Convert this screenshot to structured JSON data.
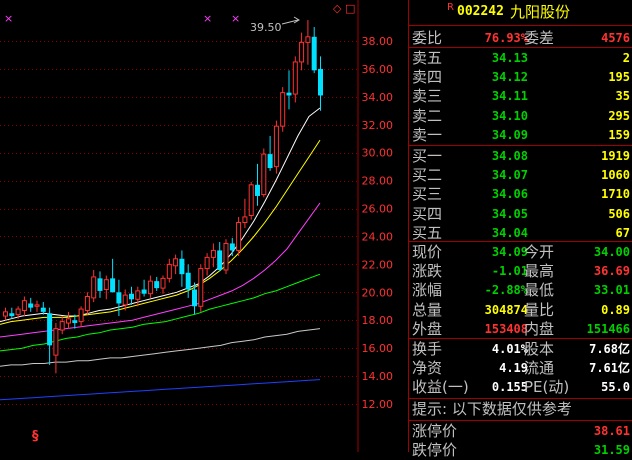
{
  "colors": {
    "up": "#ff3232",
    "down": "#00e0ff",
    "green": "#00d000",
    "yellow": "#ffff00",
    "gray": "#c0c0c0",
    "white": "#ffffff",
    "grid": "#8b0000",
    "ma_white": "#ffffff",
    "ma_yellow": "#ffff00",
    "ma_magenta": "#ff40ff",
    "ma_green": "#00ff00",
    "ma_gray": "#c8c8c8",
    "ma_blue": "#2040ff"
  },
  "header": {
    "r_mark": "R",
    "code": "002242",
    "name": "九阳股份"
  },
  "chart": {
    "top_markers": [
      "×",
      "×",
      "×"
    ],
    "top_right_icons": [
      "◇",
      "□"
    ],
    "bottom_marker": "§",
    "high_label": "39.50"
  },
  "chart_data": {
    "type": "candlestick",
    "y_axis_ticks": [
      "38.00",
      "36.00",
      "34.00",
      "32.00",
      "30.00",
      "28.00",
      "26.00",
      "24.00",
      "22.00",
      "20.00",
      "18.00",
      "16.00",
      "14.00",
      "12.00"
    ],
    "ylim": [
      12,
      38
    ],
    "annotations": [
      {
        "label": "39.50",
        "kind": "period high"
      }
    ],
    "candles": [
      [
        18.3,
        18.9,
        18.0,
        18.6
      ],
      [
        18.5,
        18.9,
        18.1,
        18.3
      ],
      [
        18.4,
        19.0,
        18.1,
        18.8
      ],
      [
        18.7,
        19.7,
        18.3,
        19.4
      ],
      [
        19.2,
        19.6,
        18.6,
        18.9
      ],
      [
        19.0,
        19.4,
        18.6,
        19.1
      ],
      [
        18.9,
        19.3,
        18.4,
        18.6
      ],
      [
        18.5,
        18.9,
        14.8,
        16.2
      ],
      [
        15.5,
        17.8,
        14.2,
        17.4
      ],
      [
        17.3,
        18.3,
        17.0,
        17.9
      ],
      [
        17.8,
        18.6,
        17.4,
        18.1
      ],
      [
        18.0,
        18.4,
        17.4,
        17.8
      ],
      [
        17.9,
        19.0,
        17.5,
        18.8
      ],
      [
        18.7,
        20.0,
        18.4,
        19.7
      ],
      [
        19.6,
        21.6,
        19.3,
        21.1
      ],
      [
        21.0,
        21.5,
        19.6,
        20.1
      ],
      [
        20.2,
        21.2,
        19.5,
        20.9
      ],
      [
        21.0,
        22.4,
        20.5,
        20.0
      ],
      [
        20.0,
        20.9,
        18.3,
        19.2
      ],
      [
        19.1,
        20.2,
        18.7,
        19.8
      ],
      [
        19.9,
        20.4,
        19.1,
        19.5
      ],
      [
        19.5,
        20.4,
        19.0,
        20.1
      ],
      [
        20.2,
        20.9,
        19.7,
        19.9
      ],
      [
        19.9,
        21.2,
        19.6,
        20.8
      ],
      [
        20.8,
        21.1,
        20.1,
        20.3
      ],
      [
        20.3,
        21.2,
        19.9,
        21.0
      ],
      [
        21.0,
        22.4,
        20.7,
        22.0
      ],
      [
        21.9,
        22.7,
        21.3,
        22.4
      ],
      [
        22.4,
        23.0,
        20.4,
        21.3
      ],
      [
        21.4,
        22.0,
        19.6,
        20.2
      ],
      [
        20.2,
        20.7,
        18.4,
        19.0
      ],
      [
        19.0,
        22.0,
        18.6,
        21.7
      ],
      [
        21.7,
        22.8,
        21.2,
        22.5
      ],
      [
        22.5,
        23.5,
        21.8,
        23.0
      ],
      [
        23.0,
        23.6,
        21.5,
        21.6
      ],
      [
        21.6,
        23.8,
        21.3,
        23.5
      ],
      [
        23.5,
        23.9,
        22.6,
        23.0
      ],
      [
        23.0,
        25.4,
        22.6,
        25.0
      ],
      [
        25.0,
        26.7,
        24.6,
        25.4
      ],
      [
        25.5,
        27.9,
        25.2,
        27.7
      ],
      [
        27.7,
        29.2,
        26.2,
        26.9
      ],
      [
        27.0,
        30.3,
        26.8,
        29.9
      ],
      [
        29.9,
        31.2,
        28.7,
        28.9
      ],
      [
        29.0,
        32.3,
        28.5,
        31.9
      ],
      [
        31.9,
        34.7,
        31.5,
        34.3
      ],
      [
        34.3,
        35.9,
        33.1,
        34.1
      ],
      [
        34.2,
        36.9,
        33.6,
        36.5
      ],
      [
        36.5,
        38.6,
        35.9,
        37.9
      ],
      [
        37.9,
        39.5,
        36.3,
        38.3
      ],
      [
        38.3,
        39.0,
        35.7,
        35.9
      ],
      [
        36.0,
        36.9,
        33.0,
        34.1
      ]
    ],
    "moving_averages": [
      {
        "color_key": "ma_white",
        "start": 17.9,
        "points": [
          18.1,
          18.3,
          18.4,
          18.5,
          18.4,
          18.3,
          18.3,
          18.5,
          18.7,
          18.8,
          19.0,
          19.2,
          19.4,
          19.6,
          19.8,
          20.0,
          20.3,
          20.6,
          21.2,
          21.9,
          22.8,
          23.9,
          25.1,
          26.5,
          28.0,
          29.6,
          31.2,
          32.6,
          33.2
        ]
      },
      {
        "color_key": "ma_yellow",
        "start": 17.7,
        "points": [
          17.9,
          18.0,
          18.1,
          18.2,
          18.2,
          18.2,
          18.3,
          18.4,
          18.5,
          18.6,
          18.8,
          19.0,
          19.2,
          19.4,
          19.6,
          19.8,
          20.1,
          20.5,
          21.0,
          21.6,
          22.3,
          23.1,
          24.0,
          25.0,
          26.1,
          27.3,
          28.5,
          29.7,
          30.9
        ]
      },
      {
        "color_key": "ma_magenta",
        "start": 16.8,
        "points": [
          16.9,
          17.0,
          17.1,
          17.2,
          17.3,
          17.4,
          17.5,
          17.6,
          17.7,
          17.8,
          17.9,
          18.0,
          18.2,
          18.4,
          18.6,
          18.8,
          19.0,
          19.2,
          19.5,
          19.8,
          20.1,
          20.5,
          21.0,
          21.6,
          22.3,
          23.1,
          24.2,
          25.3,
          26.4
        ]
      },
      {
        "color_key": "ma_green",
        "start": 15.8,
        "points": [
          15.9,
          16.0,
          16.2,
          16.3,
          16.5,
          16.7,
          16.8,
          17.0,
          17.1,
          17.3,
          17.4,
          17.5,
          17.7,
          17.8,
          17.9,
          18.1,
          18.3,
          18.5,
          18.8,
          19.0,
          19.2,
          19.4,
          19.6,
          19.9,
          20.1,
          20.4,
          20.7,
          21.0,
          21.3
        ]
      },
      {
        "color_key": "ma_gray",
        "start": 14.7,
        "points": [
          14.8,
          14.8,
          14.9,
          14.9,
          15.0,
          15.0,
          15.1,
          15.1,
          15.2,
          15.3,
          15.3,
          15.4,
          15.5,
          15.6,
          15.7,
          15.8,
          15.9,
          16.0,
          16.1,
          16.2,
          16.4,
          16.5,
          16.6,
          16.8,
          16.9,
          17.0,
          17.2,
          17.3,
          17.4
        ]
      },
      {
        "color_key": "ma_blue",
        "start": 12.3,
        "points": [
          12.35,
          12.4,
          12.45,
          12.5,
          12.55,
          12.6,
          12.65,
          12.7,
          12.75,
          12.8,
          12.85,
          12.9,
          12.95,
          13.0,
          13.05,
          13.1,
          13.15,
          13.2,
          13.25,
          13.3,
          13.35,
          13.4,
          13.45,
          13.5,
          13.55,
          13.6,
          13.65,
          13.7,
          13.75
        ]
      }
    ]
  },
  "quote": {
    "wei": {
      "l1": "委比",
      "v1": "76.93%",
      "l2": "委差",
      "v2": "4576"
    },
    "sell": [
      {
        "label": "卖五",
        "price": "34.13",
        "vol": "2"
      },
      {
        "label": "卖四",
        "price": "34.12",
        "vol": "195"
      },
      {
        "label": "卖三",
        "price": "34.11",
        "vol": "35"
      },
      {
        "label": "卖二",
        "price": "34.10",
        "vol": "295"
      },
      {
        "label": "卖一",
        "price": "34.09",
        "vol": "159"
      }
    ],
    "buy": [
      {
        "label": "买一",
        "price": "34.08",
        "vol": "1919"
      },
      {
        "label": "买二",
        "price": "34.07",
        "vol": "1060"
      },
      {
        "label": "买三",
        "price": "34.06",
        "vol": "1710"
      },
      {
        "label": "买四",
        "price": "34.05",
        "vol": "506"
      },
      {
        "label": "买五",
        "price": "34.04",
        "vol": "67"
      }
    ],
    "stats1": [
      {
        "l1": "现价",
        "v1": "34.09",
        "c1": "green",
        "l2": "今开",
        "v2": "34.00",
        "c2": "green"
      },
      {
        "l1": "涨跌",
        "v1": "-1.01",
        "c1": "green",
        "l2": "最高",
        "v2": "36.69",
        "c2": "up"
      },
      {
        "l1": "涨幅",
        "v1": "-2.88%",
        "c1": "green",
        "l2": "最低",
        "v2": "33.01",
        "c2": "green"
      },
      {
        "l1": "总量",
        "v1": "304874",
        "c1": "yellow",
        "l2": "量比",
        "v2": "0.89",
        "c2": "yellow"
      },
      {
        "l1": "外盘",
        "v1": "153408",
        "c1": "up",
        "l2": "内盘",
        "v2": "151466",
        "c2": "green"
      }
    ],
    "stats2": [
      {
        "l1": "换手",
        "v1": "4.01%",
        "c1": "white",
        "l2": "股本",
        "v2": "7.68亿",
        "c2": "white"
      },
      {
        "l1": "净资",
        "v1": "4.19",
        "c1": "white",
        "l2": "流通",
        "v2": "7.61亿",
        "c2": "white"
      },
      {
        "l1": "收益(一)",
        "v1": "0.155",
        "c1": "white",
        "l2": "PE(动)",
        "v2": "55.0",
        "c2": "white"
      }
    ],
    "tip": "提示: 以下数据仅供参考",
    "limits": [
      {
        "label": "涨停价",
        "value": "38.61",
        "color": "up"
      },
      {
        "label": "跌停价",
        "value": "31.59",
        "color": "green"
      }
    ]
  }
}
